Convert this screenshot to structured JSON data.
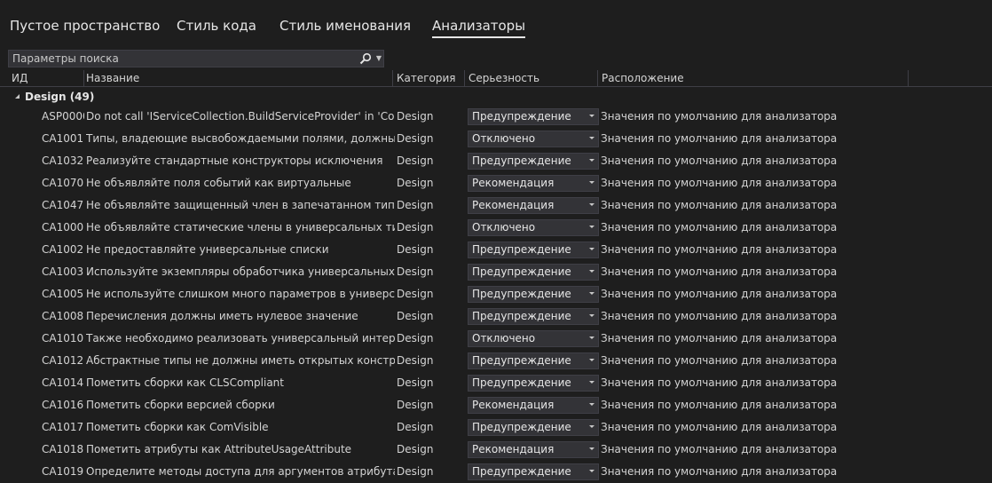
{
  "tabs": [
    "Пустое пространство",
    "Стиль кода",
    "Стиль именования",
    "Анализаторы"
  ],
  "active_tab": "Анализаторы",
  "search": {
    "placeholder": "Параметры поиска"
  },
  "columns": {
    "id": "ИД",
    "name": "Название",
    "category": "Категория",
    "severity": "Серьезность",
    "location": "Расположение"
  },
  "group": {
    "name": "Design",
    "count": "(49)"
  },
  "rows": [
    {
      "id": "ASP0000",
      "name": "Do not call 'IServiceCollection.BuildServiceProvider' in 'Configur...",
      "category": "Design",
      "severity": "Предупреждение",
      "location": "Значения по умолчанию для анализатора"
    },
    {
      "id": "CA1001",
      "name": "Типы, владеющие высвобождаемыми полями, должны быть...",
      "category": "Design",
      "severity": "Отключено",
      "location": "Значения по умолчанию для анализатора"
    },
    {
      "id": "CA1032",
      "name": "Реализуйте стандартные конструкторы исключения",
      "category": "Design",
      "severity": "Предупреждение",
      "location": "Значения по умолчанию для анализатора"
    },
    {
      "id": "CA1070",
      "name": "Не объявляйте поля событий как виртуальные",
      "category": "Design",
      "severity": "Рекомендация",
      "location": "Значения по умолчанию для анализатора"
    },
    {
      "id": "CA1047",
      "name": "Не объявляйте защищенный член в запечатанном типе",
      "category": "Design",
      "severity": "Рекомендация",
      "location": "Значения по умолчанию для анализатора"
    },
    {
      "id": "CA1000",
      "name": "Не объявляйте статические члены в универсальных типах",
      "category": "Design",
      "severity": "Отключено",
      "location": "Значения по умолчанию для анализатора"
    },
    {
      "id": "CA1002",
      "name": "Не предоставляйте универсальные списки",
      "category": "Design",
      "severity": "Предупреждение",
      "location": "Значения по умолчанию для анализатора"
    },
    {
      "id": "CA1003",
      "name": "Используйте экземпляры обработчика универсальных собы...",
      "category": "Design",
      "severity": "Предупреждение",
      "location": "Значения по умолчанию для анализатора"
    },
    {
      "id": "CA1005",
      "name": "Не используйте слишком много параметров в универсальн...",
      "category": "Design",
      "severity": "Предупреждение",
      "location": "Значения по умолчанию для анализатора"
    },
    {
      "id": "CA1008",
      "name": "Перечисления должны иметь нулевое значение",
      "category": "Design",
      "severity": "Предупреждение",
      "location": "Значения по умолчанию для анализатора"
    },
    {
      "id": "CA1010",
      "name": "Также необходимо реализовать универсальный интерфейс",
      "category": "Design",
      "severity": "Отключено",
      "location": "Значения по умолчанию для анализатора"
    },
    {
      "id": "CA1012",
      "name": "Абстрактные типы не должны иметь открытых конструкторов.",
      "category": "Design",
      "severity": "Предупреждение",
      "location": "Значения по умолчанию для анализатора"
    },
    {
      "id": "CA1014",
      "name": "Пометить сборки как CLSCompliant",
      "category": "Design",
      "severity": "Предупреждение",
      "location": "Значения по умолчанию для анализатора"
    },
    {
      "id": "CA1016",
      "name": "Пометить сборки версией сборки",
      "category": "Design",
      "severity": "Рекомендация",
      "location": "Значения по умолчанию для анализатора"
    },
    {
      "id": "CA1017",
      "name": "Пометить сборки как ComVisible",
      "category": "Design",
      "severity": "Предупреждение",
      "location": "Значения по умолчанию для анализатора"
    },
    {
      "id": "CA1018",
      "name": "Пометить атрибуты как AttributeUsageAttribute",
      "category": "Design",
      "severity": "Рекомендация",
      "location": "Значения по умолчанию для анализатора"
    },
    {
      "id": "CA1019",
      "name": "Определите методы доступа для аргументов атрибута",
      "category": "Design",
      "severity": "Предупреждение",
      "location": "Значения по умолчанию для анализатора"
    }
  ]
}
